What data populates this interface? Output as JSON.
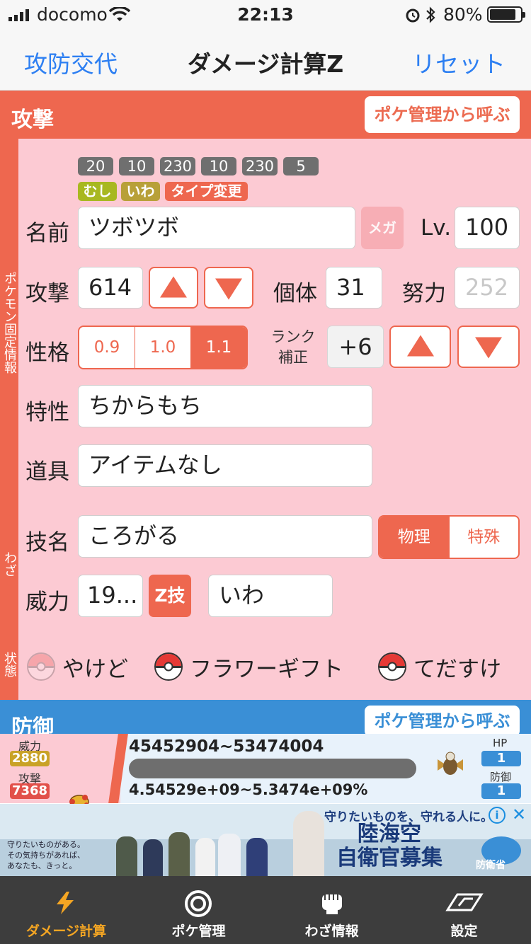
{
  "status_bar": {
    "carrier": "docomo",
    "time": "22:13",
    "battery": "80%"
  },
  "nav": {
    "left": "攻防交代",
    "title": "ダメージ計算Z",
    "right": "リセット"
  },
  "attack": {
    "header": "攻撃",
    "call_button": "ポケ管理から呼ぶ",
    "side_labels": {
      "pokemon": "ポケモン固定情報",
      "move": "わざ",
      "status": "状態"
    },
    "base_stats": [
      "20",
      "10",
      "230",
      "10",
      "230",
      "5"
    ],
    "types": [
      {
        "label": "むし",
        "color": "#a8b820"
      },
      {
        "label": "いわ",
        "color": "#b8a038"
      },
      {
        "label": "タイプ変更",
        "color": "#ee674f"
      }
    ],
    "name_label": "名前",
    "name_value": "ツボツボ",
    "mega_label": "メガ",
    "level_label": "Lv.",
    "level_value": "100",
    "attack_label": "攻撃",
    "attack_value": "614",
    "iv_label": "個体",
    "iv_value": "31",
    "ev_label": "努力",
    "ev_placeholder": "252",
    "nature_label": "性格",
    "nature_options": [
      "0.9",
      "1.0",
      "1.1"
    ],
    "nature_selected": "1.1",
    "rank_label": "ランク\n補正",
    "rank_value": "+6",
    "ability_label": "特性",
    "ability_value": "ちからもち",
    "item_label": "道具",
    "item_value": "アイテムなし",
    "move_label": "技名",
    "move_value": "ころがる",
    "category_options": [
      "物理",
      "特殊"
    ],
    "category_selected": "物理",
    "power_label": "威力",
    "power_value": "19...",
    "zmove_label": "Z技",
    "move_type": "いわ",
    "toggles": [
      {
        "label": "やけど",
        "active": false
      },
      {
        "label": "フラワーギフト",
        "active": true
      },
      {
        "label": "てだすけ",
        "active": true
      }
    ]
  },
  "defense": {
    "header": "防御",
    "call_button": "ポケ管理から呼ぶ"
  },
  "result": {
    "power_label": "威力",
    "power_value": "2880",
    "attack_label": "攻撃",
    "attack_value": "7368",
    "damage_range": "45452904~53474004",
    "percent_range": "4.54529e+09~5.3474e+09%",
    "hp_label": "HP",
    "hp_value": "1",
    "def_label": "防御",
    "def_value": "1"
  },
  "ad": {
    "top_text": "守りたいものを、守れる人に。",
    "main_text": "陸海空\n自衛官募集",
    "left_text": "守りたいものがある。\nその気持ちがあれば、\nあなたも、きっと。",
    "org": "防衛省"
  },
  "tabs": [
    {
      "label": "ダメージ計算",
      "active": true
    },
    {
      "label": "ポケ管理",
      "active": false
    },
    {
      "label": "わざ情報",
      "active": false
    },
    {
      "label": "設定",
      "active": false
    }
  ],
  "colors": {
    "accent": "#ee674f",
    "pink": "#fccad3",
    "blue": "#3a8fd6",
    "link": "#2d7ff2",
    "tab_active": "#f5a623"
  }
}
